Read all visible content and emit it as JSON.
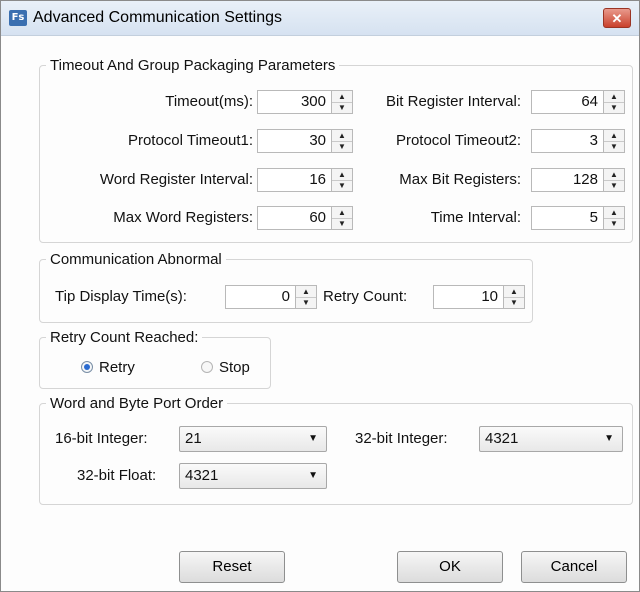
{
  "window": {
    "title": "Advanced Communication Settings",
    "app_icon": "Fs",
    "close_symbol": "✕"
  },
  "timeout_group": {
    "legend": "Timeout And Group Packaging Parameters",
    "timeout_label": "Timeout(ms):",
    "timeout_value": "300",
    "bit_register_interval_label": "Bit Register Interval:",
    "bit_register_interval_value": "64",
    "protocol_timeout1_label": "Protocol Timeout1:",
    "protocol_timeout1_value": "30",
    "protocol_timeout2_label": "Protocol Timeout2:",
    "protocol_timeout2_value": "3",
    "word_register_interval_label": "Word Register Interval:",
    "word_register_interval_value": "16",
    "max_bit_registers_label": "Max Bit Registers:",
    "max_bit_registers_value": "128",
    "max_word_registers_label": "Max Word Registers:",
    "max_word_registers_value": "60",
    "time_interval_label": "Time Interval:",
    "time_interval_value": "5"
  },
  "abnormal_group": {
    "legend": "Communication Abnormal",
    "tip_display_time_label": "Tip Display Time(s):",
    "tip_display_time_value": "0",
    "retry_count_label": "Retry Count:",
    "retry_count_value": "10"
  },
  "retry_group": {
    "legend": "Retry Count Reached:",
    "retry_label": "Retry",
    "stop_label": "Stop",
    "selected": "Retry"
  },
  "order_group": {
    "legend": "Word and Byte Port Order",
    "int16_label": "16-bit Integer:",
    "int16_value": "21",
    "int32_label": "32-bit Integer:",
    "int32_value": "4321",
    "float32_label": "32-bit Float:",
    "float32_value": "4321"
  },
  "buttons": {
    "reset": "Reset",
    "ok": "OK",
    "cancel": "Cancel"
  },
  "icons": {
    "spin_up": "▲",
    "spin_down": "▼",
    "dropdown": "▼"
  }
}
